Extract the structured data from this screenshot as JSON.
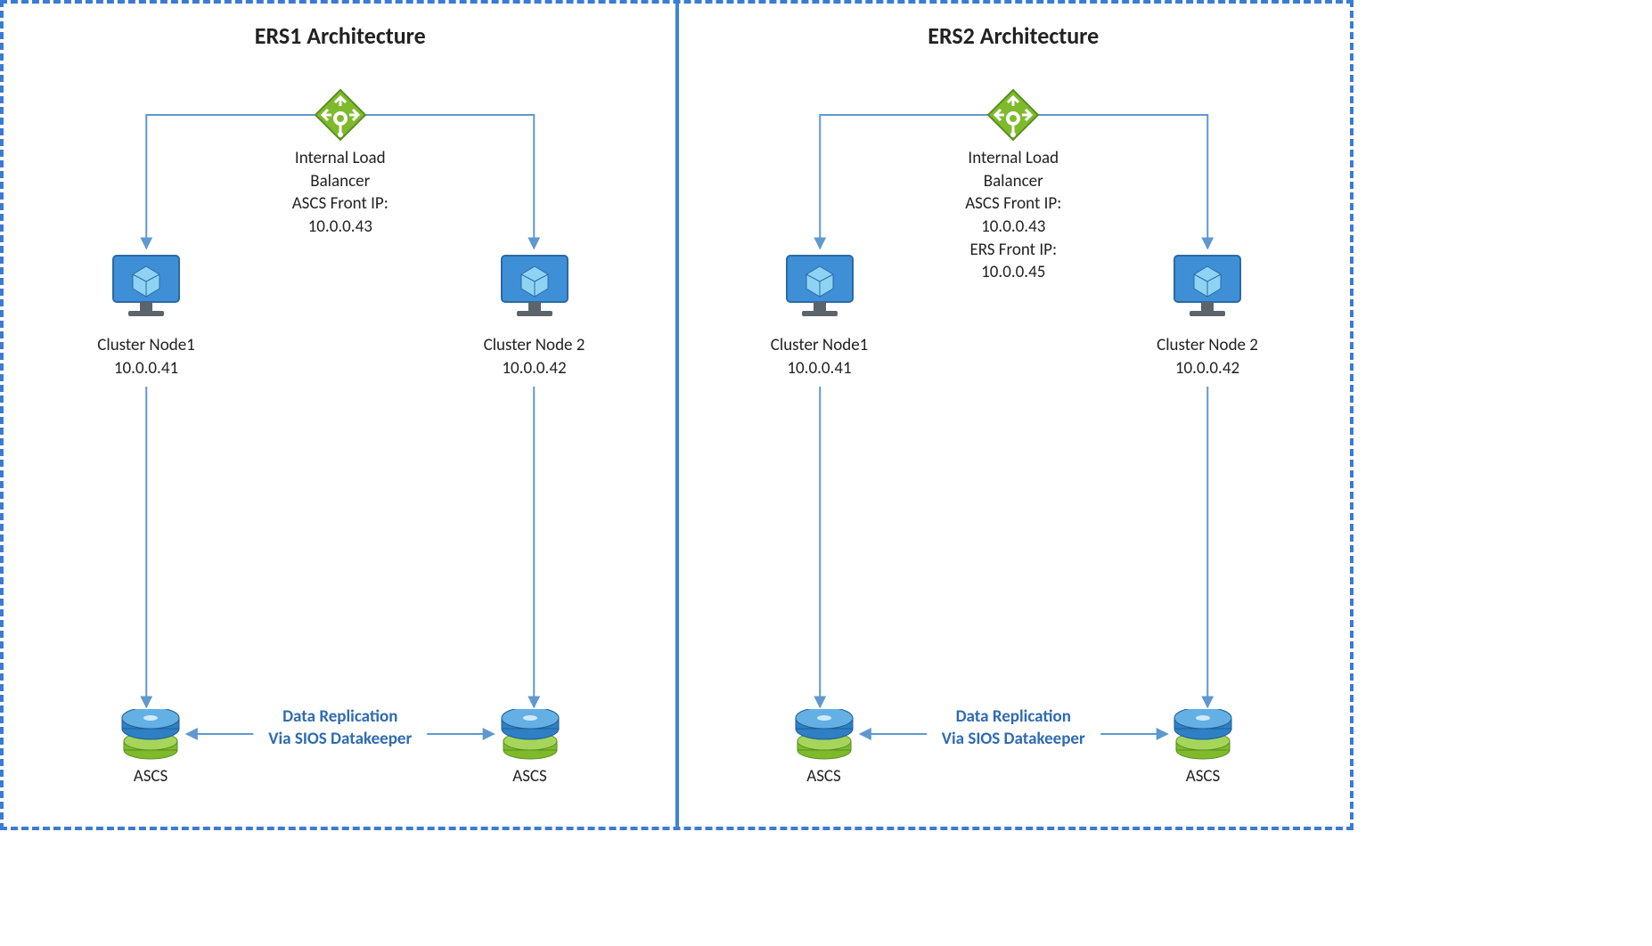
{
  "panels": [
    {
      "title": "ERS1 Architecture",
      "ilb_lines": "Internal Load\nBalancer\nASCS Front IP:\n10.0.0.43",
      "node_left": {
        "name": "Cluster Node1",
        "ip": "10.0.0.41"
      },
      "node_right": {
        "name": "Cluster Node 2",
        "ip": "10.0.0.42"
      },
      "disk_left": "ASCS",
      "disk_right": "ASCS",
      "repl_lines": "Data Replication\nVia SIOS Datakeeper"
    },
    {
      "title": "ERS2 Architecture",
      "ilb_lines": "Internal Load\nBalancer\nASCS Front IP:\n10.0.0.43\nERS Front IP:\n10.0.0.45",
      "node_left": {
        "name": "Cluster Node1",
        "ip": "10.0.0.41"
      },
      "node_right": {
        "name": "Cluster Node 2",
        "ip": "10.0.0.42"
      },
      "disk_left": "ASCS",
      "disk_right": "ASCS",
      "repl_lines": "Data Replication\nVia SIOS Datakeeper"
    }
  ]
}
